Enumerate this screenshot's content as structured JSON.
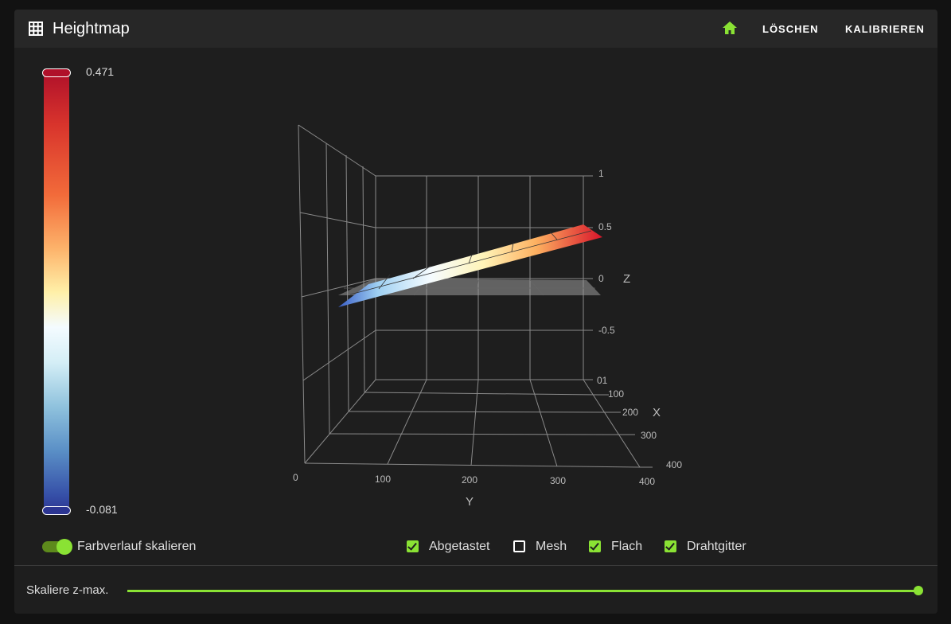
{
  "header": {
    "title": "Heightmap",
    "icon": "grid-icon",
    "home_icon": "home-icon",
    "clear_label": "LÖSCHEN",
    "calibrate_label": "KALIBRIEREN"
  },
  "colorbar": {
    "max": "0.471",
    "min": "-0.081"
  },
  "chart_data": {
    "type": "surface3d",
    "x_label": "X",
    "y_label": "Y",
    "z_label": "Z",
    "x_ticks": [
      "100",
      "200",
      "300",
      "400"
    ],
    "y_ticks": [
      "0",
      "100",
      "200",
      "300",
      "400"
    ],
    "z_ticks": [
      "1",
      "0.5",
      "0",
      "-0.5",
      "01"
    ],
    "z_range": [
      -1,
      1
    ],
    "surface_min": -0.081,
    "surface_max": 0.471
  },
  "controls": {
    "scale_gradient_label": "Farbverlauf skalieren",
    "scale_gradient_on": true,
    "checkboxes": [
      {
        "label": "Abgetastet",
        "checked": true
      },
      {
        "label": "Mesh",
        "checked": false
      },
      {
        "label": "Flach",
        "checked": true
      },
      {
        "label": "Drahtgitter",
        "checked": true
      }
    ],
    "zmax_label": "Skaliere z-max.",
    "zmax_value": 1.0
  },
  "colors": {
    "accent": "#8ae234"
  }
}
